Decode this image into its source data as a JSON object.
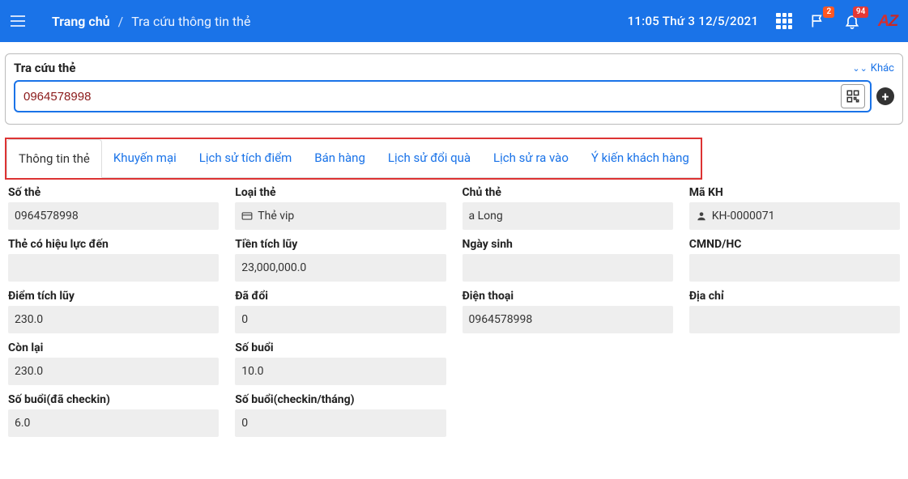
{
  "header": {
    "home_label": "Trang chủ",
    "page_label": "Tra cứu thông tin thẻ",
    "datetime": "11:05  Thứ 3 12/5/2021",
    "badge_flag": "2",
    "badge_bell": "94"
  },
  "search": {
    "panel_title": "Tra cứu thẻ",
    "other_label": "Khác",
    "value": "0964578998"
  },
  "tabs": [
    "Thông tin thẻ",
    "Khuyến mại",
    "Lịch sử tích điểm",
    "Bán hàng",
    "Lịch sử đổi quà",
    "Lịch sử ra vào",
    "Ý kiến khách hàng"
  ],
  "fields": {
    "so_the": {
      "label": "Số thẻ",
      "value": "0964578998"
    },
    "loai_the": {
      "label": "Loại thẻ",
      "value": "Thẻ vip"
    },
    "chu_the": {
      "label": "Chủ thẻ",
      "value": "a Long"
    },
    "ma_kh": {
      "label": "Mã KH",
      "value": "KH-0000071"
    },
    "hieu_luc": {
      "label": "Thẻ có hiệu lực đến",
      "value": ""
    },
    "tien_tich_luy": {
      "label": "Tiền tích lũy",
      "value": "23,000,000.0"
    },
    "ngay_sinh": {
      "label": "Ngày sinh",
      "value": ""
    },
    "cmnd": {
      "label": "CMND/HC",
      "value": ""
    },
    "diem_tich_luy": {
      "label": "Điểm tích lũy",
      "value": "230.0"
    },
    "da_doi": {
      "label": "Đã đổi",
      "value": "0"
    },
    "dien_thoai": {
      "label": "Điện thoại",
      "value": "0964578998"
    },
    "dia_chi": {
      "label": "Địa chỉ",
      "value": ""
    },
    "con_lai": {
      "label": "Còn lại",
      "value": "230.0"
    },
    "so_buoi": {
      "label": "Số buổi",
      "value": "10.0"
    },
    "so_buoi_checkin": {
      "label": "Số buổi(đã checkin)",
      "value": "6.0"
    },
    "so_buoi_thang": {
      "label": "Số buổi(checkin/tháng)",
      "value": "0"
    }
  }
}
